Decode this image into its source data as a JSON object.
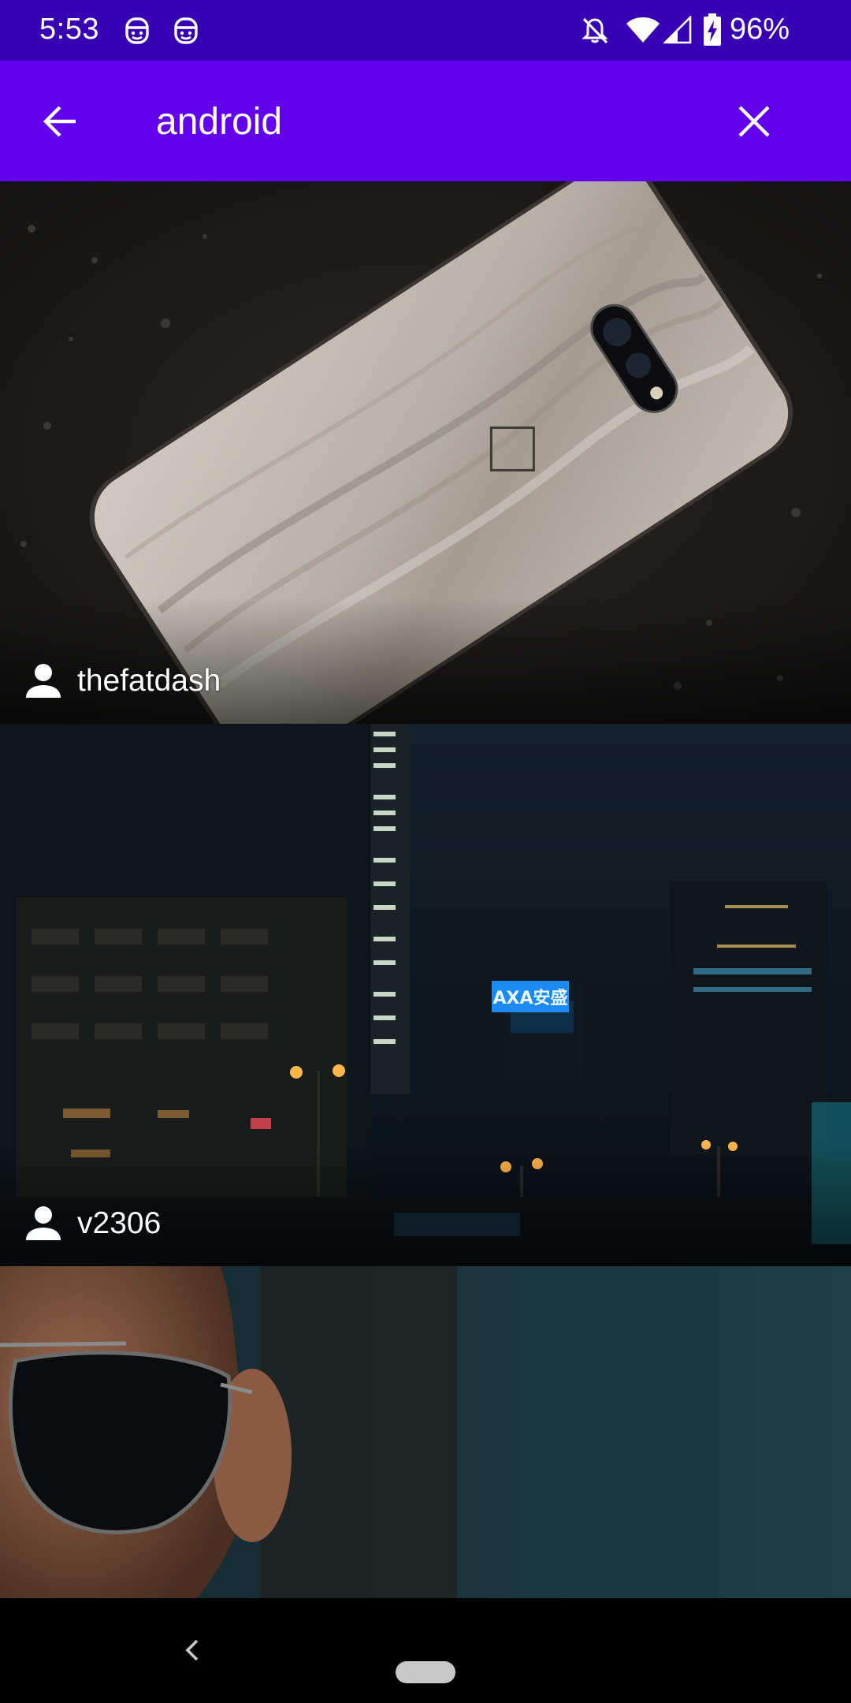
{
  "status_bar": {
    "time": "5:53",
    "battery_percent": "96%",
    "left_icons": [
      "face-notification-icon",
      "face-notification-icon"
    ],
    "right_icons": [
      "notifications-off-icon",
      "wifi-icon",
      "cell-signal-icon",
      "battery-charging-icon"
    ],
    "background_color": "#3700b3"
  },
  "app_bar": {
    "background_color": "#6200ee",
    "search_query": "android",
    "back_icon": "arrow-back-icon",
    "clear_icon": "close-icon"
  },
  "photos": [
    {
      "author": "thefatdash",
      "description_icon": "person-icon"
    },
    {
      "author": "v2306",
      "description_icon": "person-icon",
      "sign_text": "AXA安盛"
    },
    {
      "author": "",
      "description_icon": "person-icon"
    }
  ],
  "nav_bar": {
    "back_icon": "nav-back-icon",
    "home_icon": "nav-home-pill"
  }
}
